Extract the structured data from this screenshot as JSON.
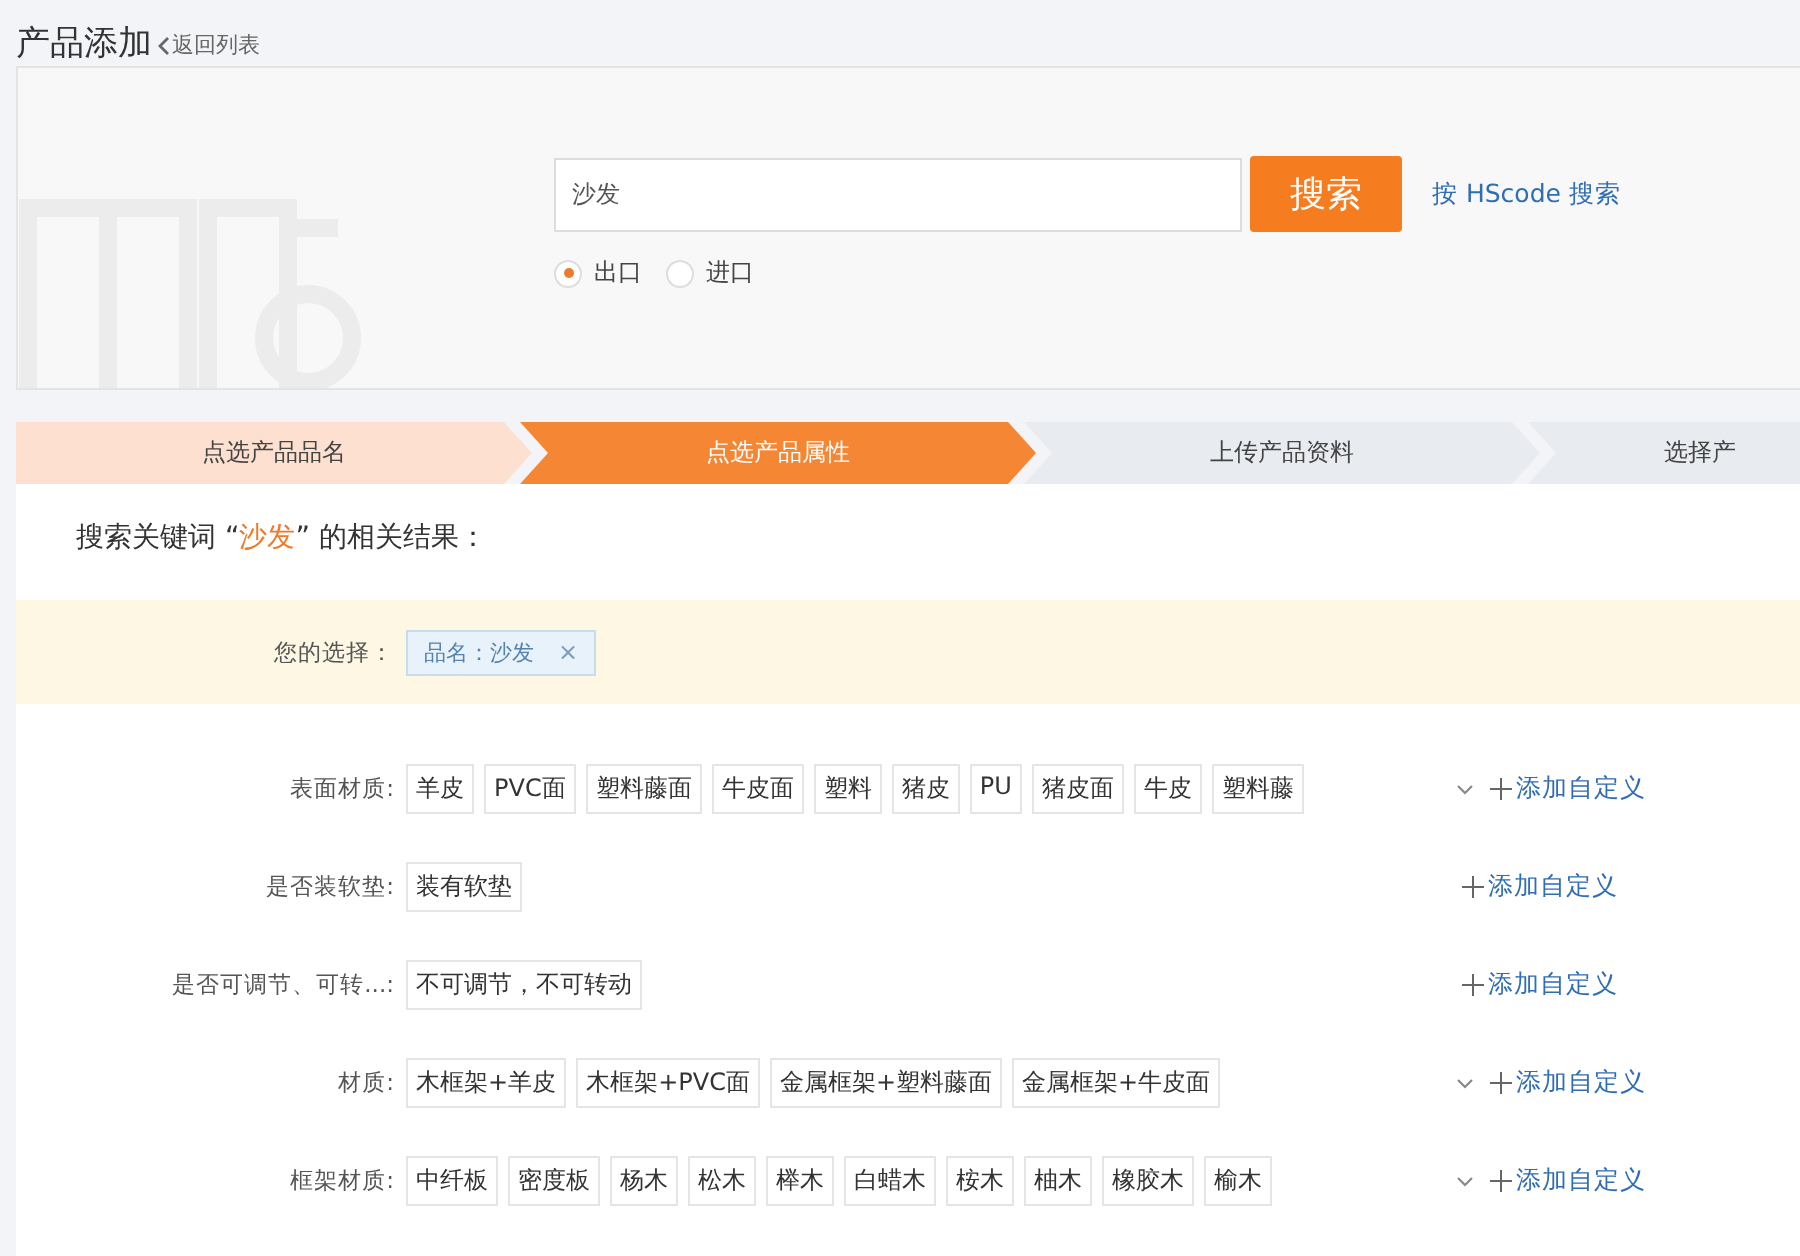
{
  "header": {
    "title": "产品添加",
    "back_link": "返回列表"
  },
  "search": {
    "value": "沙发",
    "button": "搜索",
    "hs_link": "按 HScode 搜索",
    "trade_options": [
      {
        "label": "出口",
        "selected": true
      },
      {
        "label": "进口",
        "selected": false
      }
    ]
  },
  "steps": [
    {
      "label": "点选产品品名",
      "done": true,
      "selected": false
    },
    {
      "label": "点选产品属性",
      "done": false,
      "selected": true
    },
    {
      "label": "上传产品资料",
      "done": false,
      "selected": false
    },
    {
      "label": "选择产",
      "done": false,
      "selected": false
    }
  ],
  "result_heading": {
    "prefix": "搜索关键词 “",
    "keyword": "沙发",
    "suffix": "” 的相关结果："
  },
  "selection": {
    "label": "您的选择：",
    "chips": [
      {
        "text": "品名：沙发",
        "remove": "×"
      }
    ]
  },
  "attributes": [
    {
      "label": "表面材质:",
      "expandable": true,
      "options": [
        "羊皮",
        "PVC面",
        "塑料藤面",
        "牛皮面",
        "塑料",
        "猪皮",
        "PU",
        "猪皮面",
        "牛皮",
        "塑料藤"
      ],
      "add": "添加自定义"
    },
    {
      "label": "是否装软垫:",
      "expandable": false,
      "options": [
        "装有软垫"
      ],
      "add": "添加自定义"
    },
    {
      "label": "是否可调节、可转...:",
      "expandable": false,
      "options": [
        "不可调节，不可转动"
      ],
      "add": "添加自定义"
    },
    {
      "label": "材质:",
      "expandable": true,
      "options": [
        "木框架+羊皮",
        "木框架+PVC面",
        "金属框架+塑料藤面",
        "金属框架+牛皮面"
      ],
      "add": "添加自定义"
    },
    {
      "label": "框架材质:",
      "expandable": true,
      "options": [
        "中纤板",
        "密度板",
        "杨木",
        "松木",
        "榉木",
        "白蜡木",
        "桉木",
        "柚木",
        "橡胶木",
        "榆木"
      ],
      "add": "添加自定义"
    }
  ]
}
